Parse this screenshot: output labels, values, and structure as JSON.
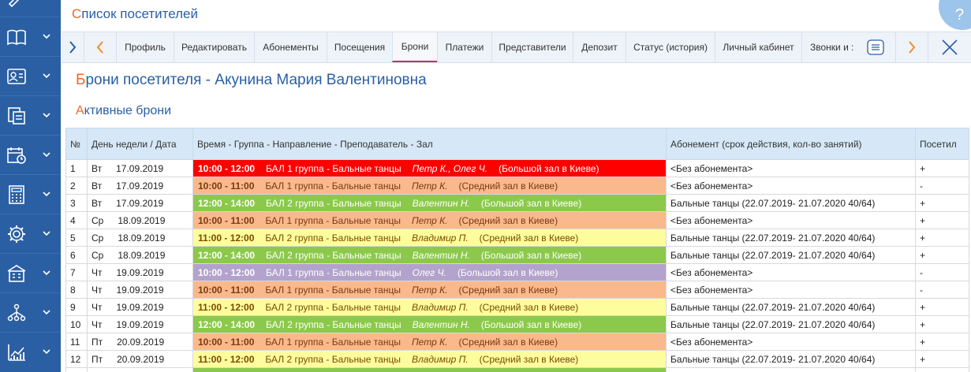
{
  "page_title": {
    "first": "С",
    "rest": "писок посетителей"
  },
  "help": {
    "label": "?"
  },
  "sidebar": {
    "items": [
      {
        "icon": "book-icon"
      },
      {
        "icon": "contact-card-icon"
      },
      {
        "icon": "documents-icon"
      },
      {
        "icon": "calendar-clock-icon"
      },
      {
        "icon": "calculator-icon"
      },
      {
        "icon": "gear-icon"
      },
      {
        "icon": "building-icon"
      },
      {
        "icon": "hierarchy-icon"
      },
      {
        "icon": "chart-icon"
      }
    ]
  },
  "tabs": [
    {
      "label": "Профиль"
    },
    {
      "label": "Редактировать"
    },
    {
      "label": "Абонементы"
    },
    {
      "label": "Посещения"
    },
    {
      "label": "Брони",
      "active": true
    },
    {
      "label": "Платежи"
    },
    {
      "label": "Представители"
    },
    {
      "label": "Депозит"
    },
    {
      "label": "Статус (история)"
    },
    {
      "label": "Личный кабинет"
    },
    {
      "label": "Звонки и :"
    }
  ],
  "heading": {
    "first": "Б",
    "rest": "рони посетителя - Акунина Мария Валентиновна"
  },
  "subheading": {
    "first": "А",
    "rest": "ктивные брони"
  },
  "table": {
    "columns": [
      "№",
      "День недели / Дата",
      "Время - Группа - Направление - Преподаватель - Зал",
      "Абонемент (срок действия, кол-во занятий)",
      "Посетил"
    ],
    "colors": {
      "red": "#ff0000",
      "salmon": "#f9b98c",
      "green": "#8cc94a",
      "yellow": "#fdfd9e",
      "purple": "#b3a3cc"
    },
    "rows": [
      {
        "num": "1",
        "day": "Вт",
        "date": "17.09.2019",
        "time": "10:00 - 12:00",
        "group": "БАЛ 1 группа - Бальные танцы",
        "teacher": "Петр К., Олег Ч.",
        "hall": "(Большой зал в Киеве)",
        "color": "red",
        "sub": "<Без абонемента>",
        "visited": "+"
      },
      {
        "num": "2",
        "day": "Вт",
        "date": "17.09.2019",
        "time": "10:00 - 11:00",
        "group": "БАЛ 1 группа - Бальные танцы",
        "teacher": "Петр К.",
        "hall": "(Средний зал в Киеве)",
        "color": "salmon",
        "sub": "<Без абонемента>",
        "visited": "-"
      },
      {
        "num": "3",
        "day": "Вт",
        "date": "17.09.2019",
        "time": "12:00 - 14:00",
        "group": "БАЛ 2 группа - Бальные танцы",
        "teacher": "Валентин Н.",
        "hall": "(Большой зал в Киеве)",
        "color": "green",
        "sub": "Бальные танцы  (22.07.2019- 21.07.2020  40/64)",
        "visited": "+"
      },
      {
        "num": "4",
        "day": "Ср",
        "date": "18.09.2019",
        "time": "10:00 - 11:00",
        "group": "БАЛ 1 группа - Бальные танцы",
        "teacher": "Петр К.",
        "hall": "(Средний зал в Киеве)",
        "color": "salmon",
        "sub": "<Без абонемента>",
        "visited": "+"
      },
      {
        "num": "5",
        "day": "Ср",
        "date": "18.09.2019",
        "time": "11:00 - 12:00",
        "group": "БАЛ 2 группа - Бальные танцы",
        "teacher": "Владимир П.",
        "hall": "(Средний зал в Киеве)",
        "color": "yellow",
        "sub": "Бальные танцы  (22.07.2019- 21.07.2020  40/64)",
        "visited": "+"
      },
      {
        "num": "6",
        "day": "Ср",
        "date": "18.09.2019",
        "time": "12:00 - 14:00",
        "group": "БАЛ 2 группа - Бальные танцы",
        "teacher": "Валентин Н.",
        "hall": "(Большой зал в Киеве)",
        "color": "green",
        "sub": "Бальные танцы  (22.07.2019- 21.07.2020  40/64)",
        "visited": "+"
      },
      {
        "num": "7",
        "day": "Чт",
        "date": "19.09.2019",
        "time": "10:00 - 12:00",
        "group": "БАЛ 1 группа - Бальные танцы",
        "teacher": "Олег Ч.",
        "hall": "(Большой зал в Киеве)",
        "color": "purple",
        "sub": "<Без абонемента>",
        "visited": "-"
      },
      {
        "num": "8",
        "day": "Чт",
        "date": "19.09.2019",
        "time": "10:00 - 11:00",
        "group": "БАЛ 1 группа - Бальные танцы",
        "teacher": "Петр К.",
        "hall": "(Средний зал в Киеве)",
        "color": "salmon",
        "sub": "<Без абонемента>",
        "visited": "-"
      },
      {
        "num": "9",
        "day": "Чт",
        "date": "19.09.2019",
        "time": "11:00 - 12:00",
        "group": "БАЛ 2 группа - Бальные танцы",
        "teacher": "Владимир П.",
        "hall": "(Средний зал в Киеве)",
        "color": "yellow",
        "sub": "Бальные танцы  (22.07.2019- 21.07.2020  40/64)",
        "visited": "+"
      },
      {
        "num": "10",
        "day": "Чт",
        "date": "19.09.2019",
        "time": "12:00 - 14:00",
        "group": "БАЛ 2 группа - Бальные танцы",
        "teacher": "Валентин Н.",
        "hall": "(Большой зал в Киеве)",
        "color": "green",
        "sub": "Бальные танцы  (22.07.2019- 21.07.2020  40/64)",
        "visited": "+"
      },
      {
        "num": "11",
        "day": "Пт",
        "date": "20.09.2019",
        "time": "10:00 - 11:00",
        "group": "БАЛ 1 группа - Бальные танцы",
        "teacher": "Петр К.",
        "hall": "(Средний зал в Киеве)",
        "color": "salmon",
        "sub": "<Без абонемента>",
        "visited": "+"
      },
      {
        "num": "12",
        "day": "Пт",
        "date": "20.09.2019",
        "time": "11:00 - 12:00",
        "group": "БАЛ 2 группа - Бальные танцы",
        "teacher": "Владимир П.",
        "hall": "(Средний зал в Киеве)",
        "color": "yellow",
        "sub": "Бальные танцы  (22.07.2019- 21.07.2020  40/64)",
        "visited": "+"
      },
      {
        "num": "",
        "day": "",
        "date": "",
        "time": "",
        "group": "",
        "teacher": "",
        "hall": "",
        "color": "green",
        "sub": "",
        "visited": ""
      }
    ]
  }
}
